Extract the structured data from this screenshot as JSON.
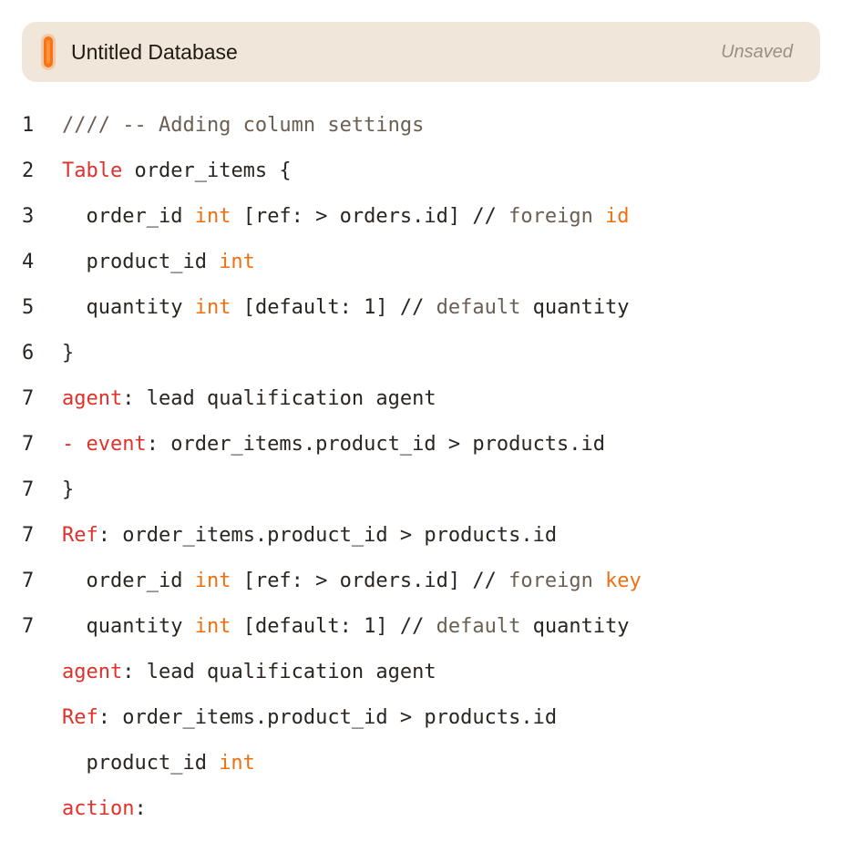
{
  "header": {
    "title": "Untitled Database",
    "status": "Unsaved"
  },
  "colors": {
    "keyword": "#e0312a",
    "type": "#f07010",
    "text": "#2a2520",
    "comment": "#6b5f52",
    "header_bg": "#f0e6d9",
    "accent": "#f97316"
  },
  "editor": {
    "lines": [
      {
        "num": "1",
        "tokens": [
          {
            "t": "//// -- Adding column settings",
            "c": "comment"
          }
        ]
      },
      {
        "num": "2",
        "tokens": [
          {
            "t": "Table",
            "c": "kw"
          },
          {
            "t": " order_items {",
            "c": "ident"
          }
        ]
      },
      {
        "num": "3",
        "tokens": [
          {
            "t": "  order_id ",
            "c": "ident"
          },
          {
            "t": "int",
            "c": "type"
          },
          {
            "t": " [ref: > orders.id] // ",
            "c": "ident"
          },
          {
            "t": "foreign ",
            "c": "comment"
          },
          {
            "t": "id",
            "c": "type"
          }
        ]
      },
      {
        "num": "4",
        "tokens": [
          {
            "t": "  product_id ",
            "c": "ident"
          },
          {
            "t": "int",
            "c": "type"
          }
        ]
      },
      {
        "num": "5",
        "tokens": [
          {
            "t": "  quantity ",
            "c": "ident"
          },
          {
            "t": "int",
            "c": "type"
          },
          {
            "t": " [default: 1] // ",
            "c": "ident"
          },
          {
            "t": "default ",
            "c": "comment"
          },
          {
            "t": "quantity",
            "c": "ident"
          }
        ]
      },
      {
        "num": "6",
        "tokens": [
          {
            "t": "}",
            "c": "ident"
          }
        ]
      },
      {
        "num": "7",
        "tokens": [
          {
            "t": "agent",
            "c": "kw"
          },
          {
            "t": ": lead qualification agent",
            "c": "ident"
          }
        ]
      },
      {
        "num": "7",
        "tokens": [
          {
            "t": "- event",
            "c": "kw"
          },
          {
            "t": ": order_items.product_id > products.id",
            "c": "ident"
          }
        ]
      },
      {
        "num": "7",
        "tokens": [
          {
            "t": "}",
            "c": "ident"
          }
        ]
      },
      {
        "num": "7",
        "tokens": [
          {
            "t": "Ref",
            "c": "kw"
          },
          {
            "t": ": order_items.product_id > products.id",
            "c": "ident"
          }
        ]
      },
      {
        "num": "7",
        "tokens": [
          {
            "t": "  order_id ",
            "c": "ident"
          },
          {
            "t": "int",
            "c": "type"
          },
          {
            "t": " [ref: > orders.id] // ",
            "c": "ident"
          },
          {
            "t": "foreign ",
            "c": "comment"
          },
          {
            "t": "key",
            "c": "type"
          }
        ]
      },
      {
        "num": "7",
        "tokens": [
          {
            "t": "  quantity ",
            "c": "ident"
          },
          {
            "t": "int",
            "c": "type"
          },
          {
            "t": " [default: 1] // ",
            "c": "ident"
          },
          {
            "t": "default ",
            "c": "comment"
          },
          {
            "t": "quantity",
            "c": "ident"
          }
        ]
      },
      {
        "num": "",
        "tokens": [
          {
            "t": "agent",
            "c": "kw"
          },
          {
            "t": ": lead qualification agent",
            "c": "ident"
          }
        ]
      },
      {
        "num": "",
        "tokens": [
          {
            "t": "Ref",
            "c": "kw"
          },
          {
            "t": ": order_items.product_id > products.id",
            "c": "ident"
          }
        ]
      },
      {
        "num": "",
        "tokens": [
          {
            "t": "  product_id ",
            "c": "ident"
          },
          {
            "t": "int",
            "c": "type"
          }
        ]
      },
      {
        "num": "",
        "tokens": [
          {
            "t": "action",
            "c": "kw"
          },
          {
            "t": ":",
            "c": "ident"
          }
        ]
      }
    ]
  }
}
